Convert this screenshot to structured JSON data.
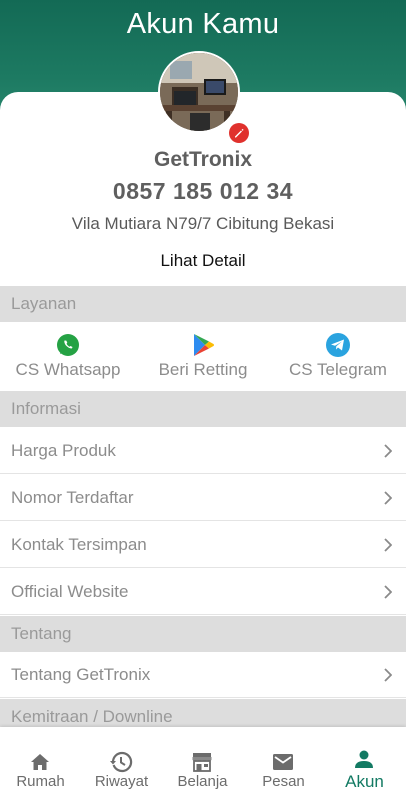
{
  "header": {
    "title": "Akun Kamu"
  },
  "profile": {
    "name": "GetTronix",
    "phone": "0857 185 012 34",
    "address": "Vila Mutiara N79/7 Cibitung Bekasi",
    "detail_link": "Lihat Detail"
  },
  "sections": {
    "layanan": "Layanan",
    "informasi": "Informasi",
    "tentang": "Tentang",
    "kemitraan": "Kemitraan / Downline"
  },
  "services": [
    {
      "label": "CS Whatsapp",
      "icon": "whatsapp-icon",
      "color": "#25a244"
    },
    {
      "label": "Beri Retting",
      "icon": "google-play-icon",
      "color": "#34a853"
    },
    {
      "label": "CS Telegram",
      "icon": "telegram-icon",
      "color": "#2aa3df"
    }
  ],
  "info_items": [
    {
      "label": "Harga Produk"
    },
    {
      "label": "Nomor Terdaftar"
    },
    {
      "label": "Kontak Tersimpan"
    },
    {
      "label": "Official Website"
    }
  ],
  "about_items": [
    {
      "label": "Tentang GetTronix"
    }
  ],
  "nav": [
    {
      "label": "Rumah",
      "icon": "home-icon"
    },
    {
      "label": "Riwayat",
      "icon": "history-icon"
    },
    {
      "label": "Belanja",
      "icon": "store-icon"
    },
    {
      "label": "Pesan",
      "icon": "mail-icon"
    },
    {
      "label": "Akun",
      "icon": "person-icon",
      "active": true
    }
  ],
  "colors": {
    "primary": "#137a63",
    "edit_badge": "#e0312d"
  }
}
